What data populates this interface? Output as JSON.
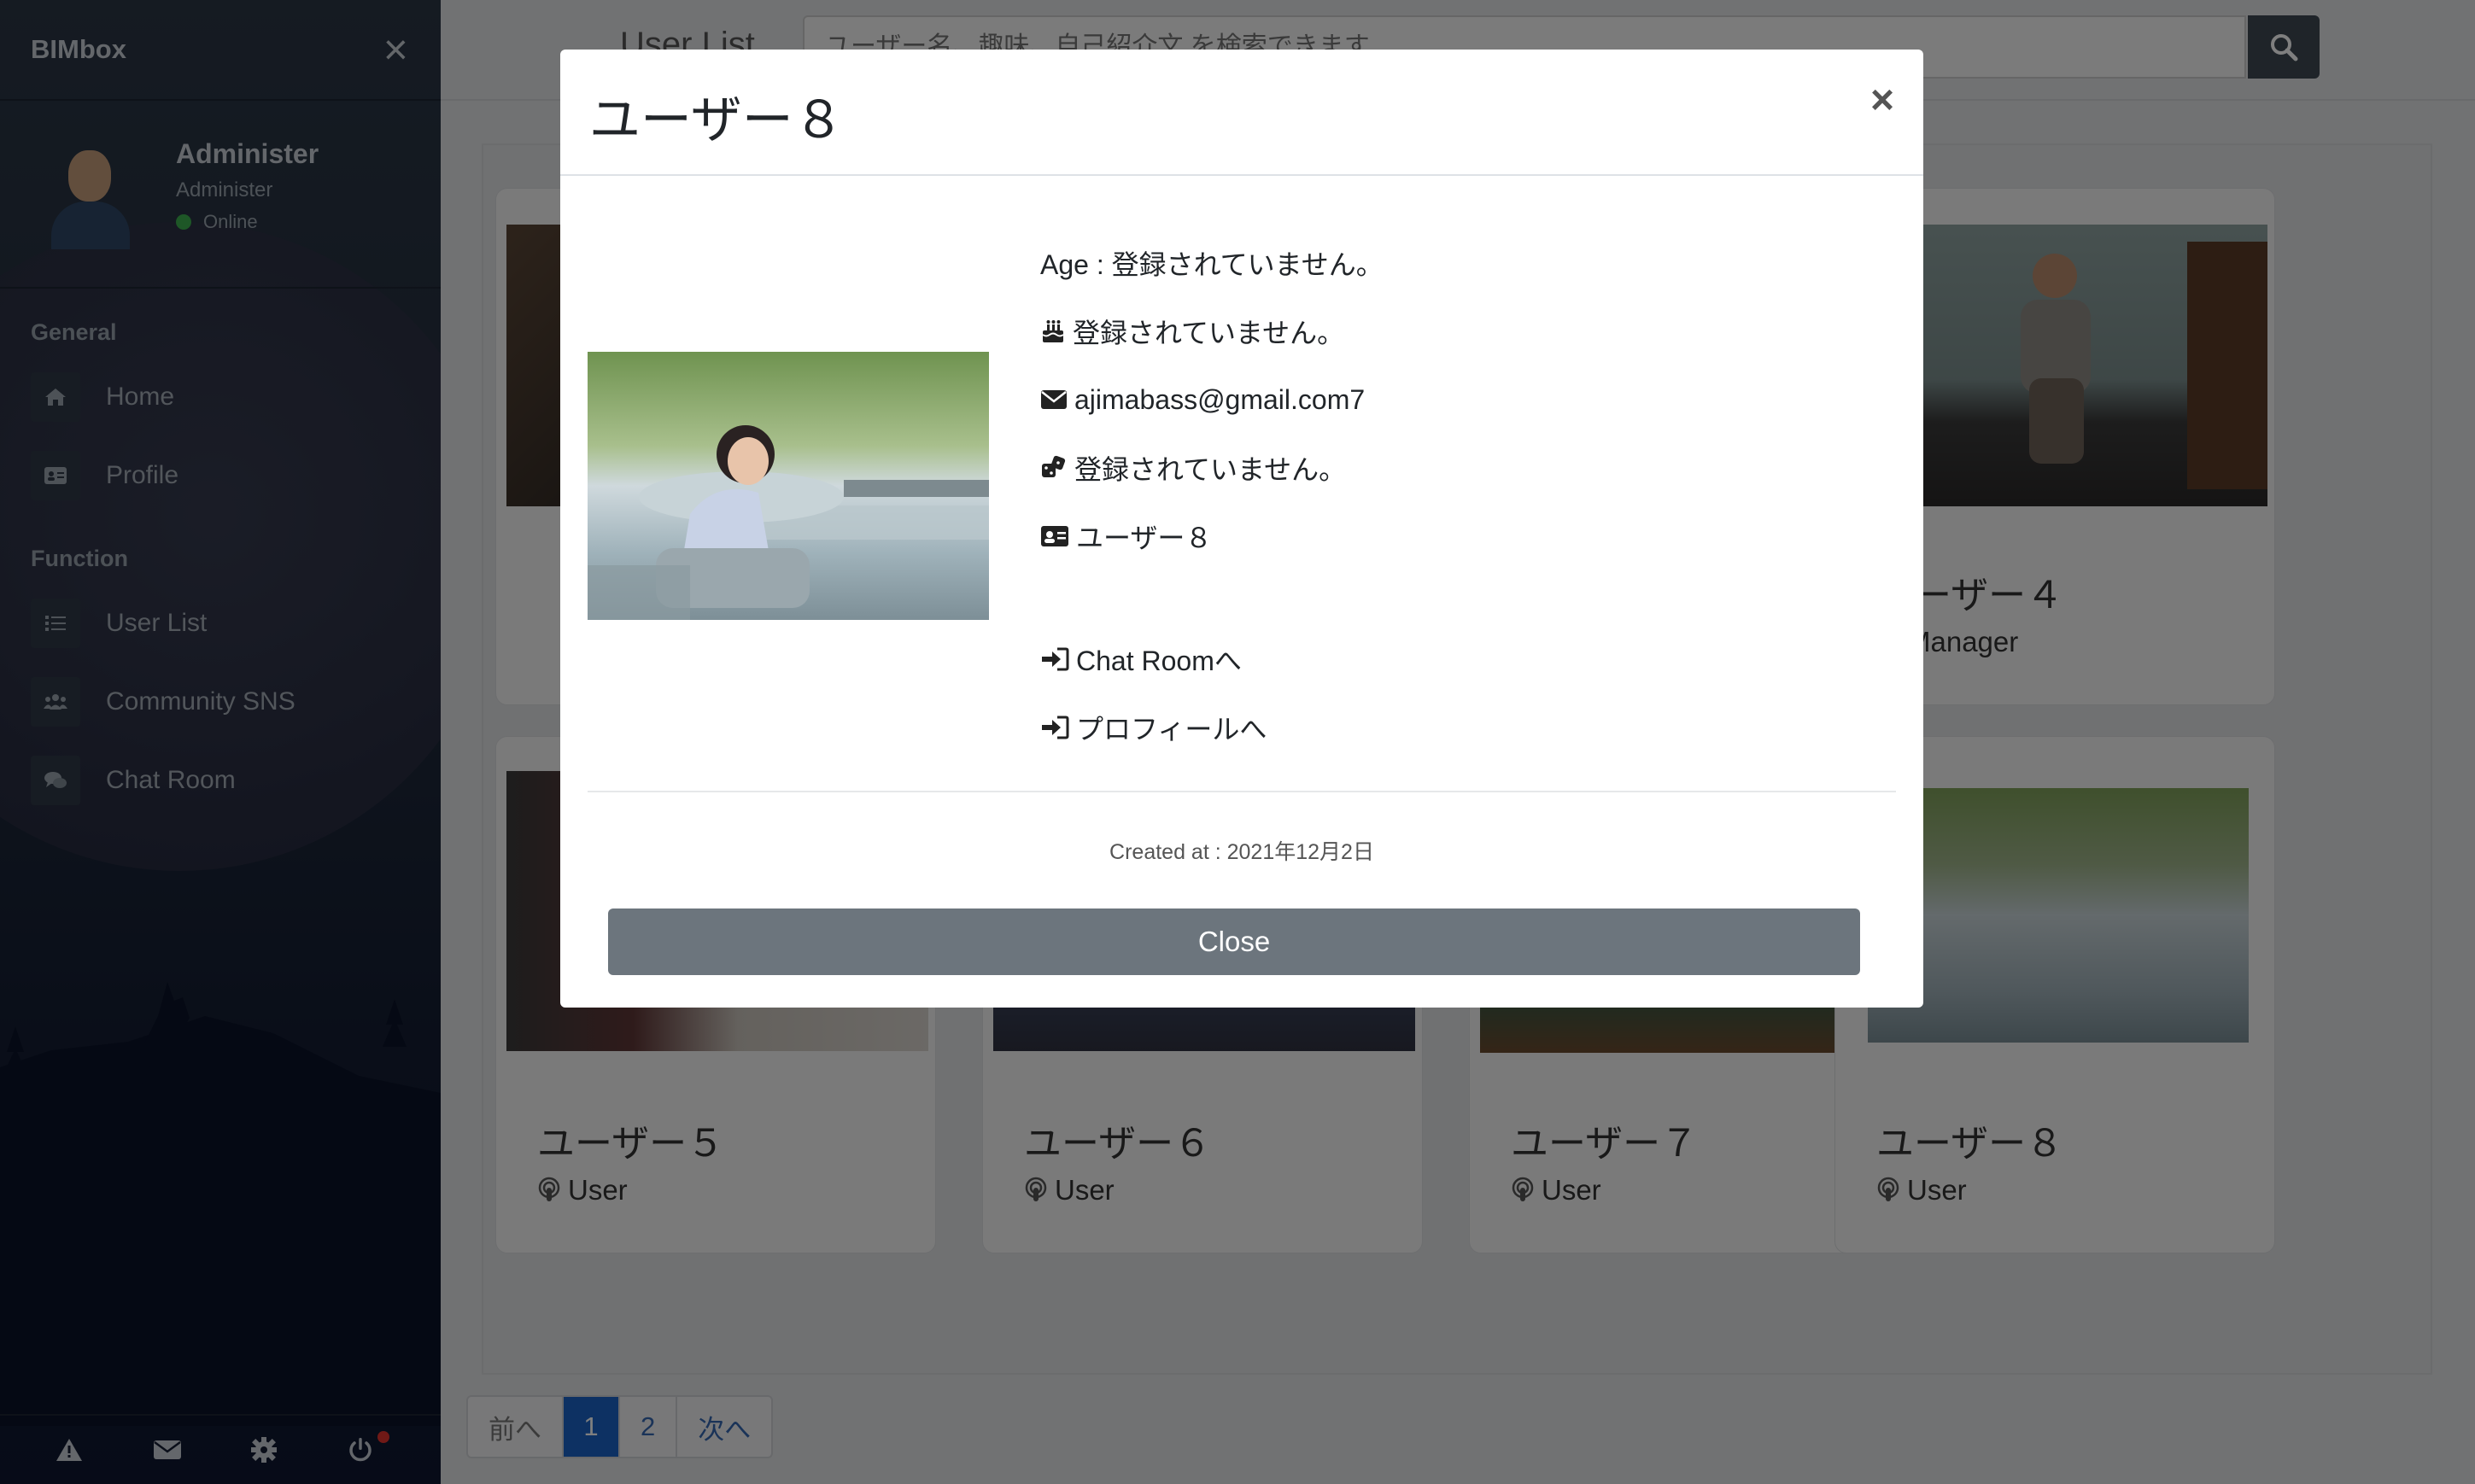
{
  "app": {
    "brand": "BIMbox"
  },
  "user": {
    "name": "Administer",
    "role": "Administer",
    "status": "Online"
  },
  "menu": {
    "general_title": "General",
    "general": [
      {
        "label": "Home"
      },
      {
        "label": "Profile"
      }
    ],
    "function_title": "Function",
    "function": [
      {
        "label": "User List"
      },
      {
        "label": "Community SNS"
      },
      {
        "label": "Chat Room"
      }
    ]
  },
  "footer_icons": [
    "warning-icon",
    "envelope-icon",
    "gear-icon",
    "power-icon"
  ],
  "header": {
    "title": "User List",
    "search_placeholder": "ユーザー名、趣味、自己紹介文 を検索できます"
  },
  "cards": [
    {
      "name": "ユーザー４",
      "role": "Manager"
    },
    {
      "name": "ユーザー５",
      "role": "User"
    },
    {
      "name": "ユーザー６",
      "role": "User"
    },
    {
      "name": "ユーザー７",
      "role": "User"
    },
    {
      "name": "ユーザー８",
      "role": "User"
    }
  ],
  "pagination": {
    "prev": "前へ",
    "pages": [
      "1",
      "2"
    ],
    "active": "1",
    "next": "次へ"
  },
  "modal": {
    "title": "ユーザー８",
    "age": "Age : 登録されていません。",
    "birthday": "登録されていません。",
    "email": "ajimabass@gmail.com7",
    "hobby": "登録されていません。",
    "profile_name": "ユーザー８",
    "chat_link": "Chat Roomへ",
    "profile_link": "プロフィールへ",
    "created": "Created at : 2021年12月2日",
    "close_button": "Close"
  },
  "colors": {
    "sidebar": "#222d3d",
    "active_page": "#1a63c6",
    "close_button": "#6c757d",
    "online": "#3cae4e"
  }
}
